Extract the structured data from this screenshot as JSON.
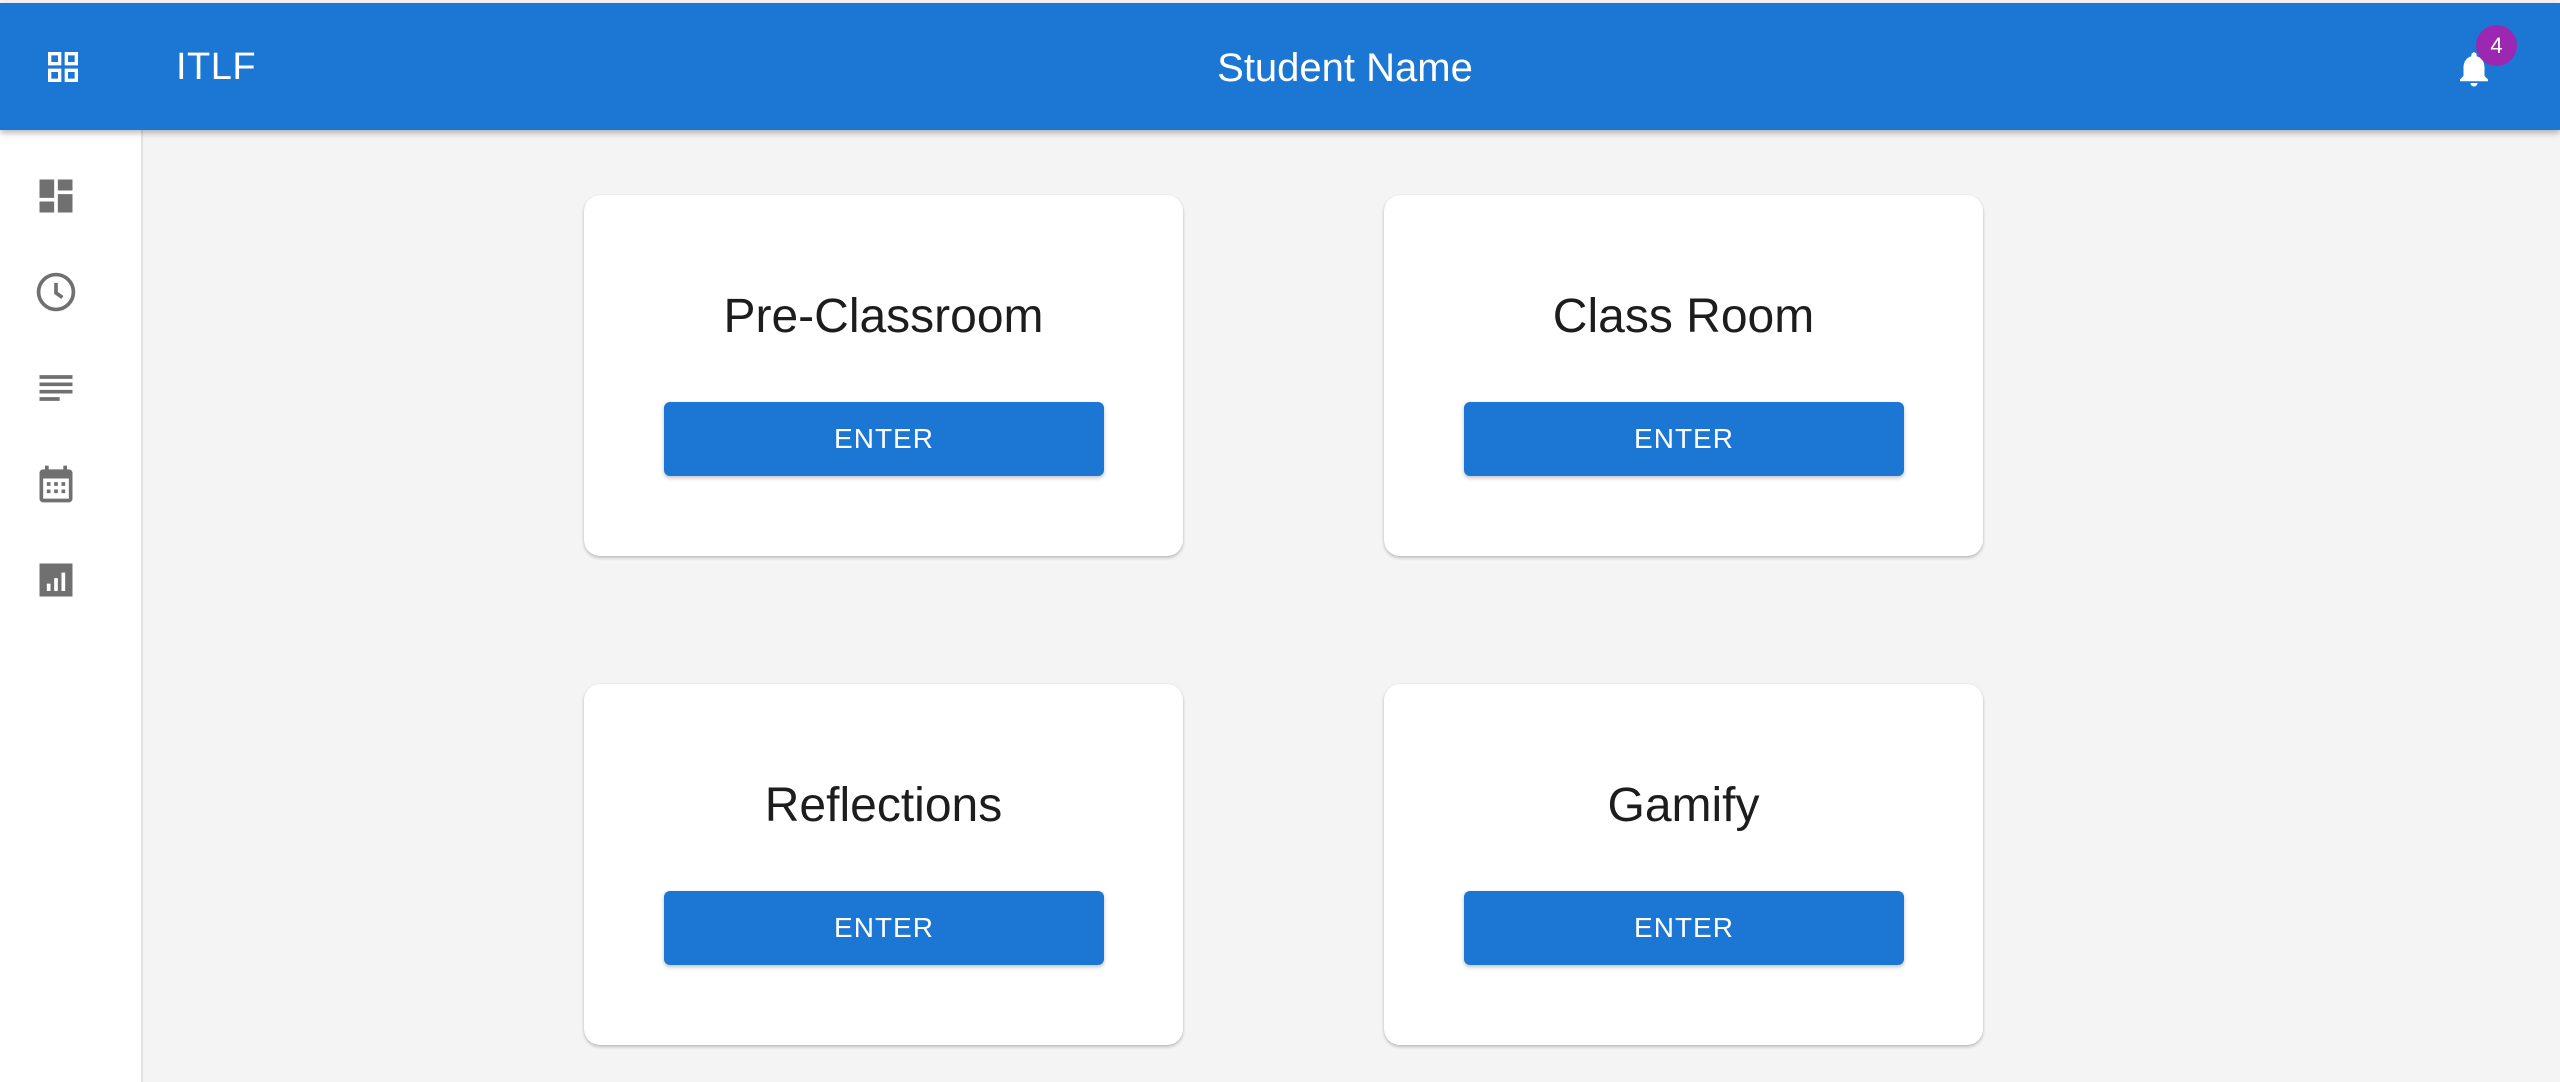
{
  "appbar": {
    "menu_icon": "apps-grid-icon",
    "brand": "ITLF",
    "title": "Student Name",
    "notifications_icon": "bell-icon",
    "notification_count": "4",
    "color": "#1c77d4",
    "badge_color": "#9c27b0"
  },
  "sidebar": {
    "items": [
      {
        "icon": "dashboard-icon"
      },
      {
        "icon": "clock-icon"
      },
      {
        "icon": "notes-icon"
      },
      {
        "icon": "calendar-icon"
      },
      {
        "icon": "bar-chart-icon"
      }
    ]
  },
  "cards": [
    {
      "title": "Pre-Classroom",
      "button": "ENTER"
    },
    {
      "title": "Class Room",
      "button": "ENTER"
    },
    {
      "title": "Reflections",
      "button": "ENTER"
    },
    {
      "title": "Gamify",
      "button": "ENTER"
    }
  ]
}
